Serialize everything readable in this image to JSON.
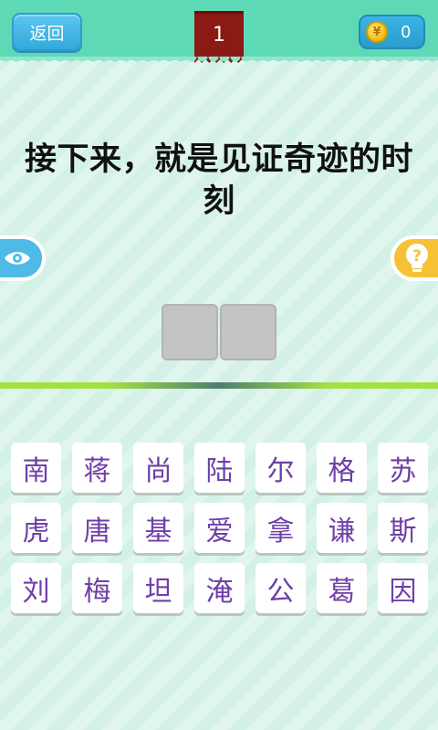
{
  "header": {
    "back_label": "返回",
    "level": "1",
    "coins": "0",
    "coin_symbol": "¥"
  },
  "question": {
    "text": "接下来，就是见证奇迹的时刻"
  },
  "side_buttons": {
    "eye_icon": "eye-icon",
    "hint_icon": "question-bulb-icon",
    "hint_symbol": "?"
  },
  "answer": {
    "slot_count": 2,
    "slots": [
      "",
      ""
    ]
  },
  "characters": [
    "南",
    "蒋",
    "尚",
    "陆",
    "尔",
    "格",
    "苏",
    "虎",
    "唐",
    "基",
    "爱",
    "拿",
    "谦",
    "斯",
    "刘",
    "梅",
    "坦",
    "淹",
    "公",
    "葛",
    "因"
  ],
  "colors": {
    "background": "#d4f1e7",
    "topbar": "#5ed9b6",
    "back_button": "#33a9dc",
    "level_badge": "#8b1a14",
    "hint_button": "#f6c137",
    "eye_button": "#4fb9e8",
    "tile_text": "#6f3fa8",
    "divider": "#a3e044"
  }
}
